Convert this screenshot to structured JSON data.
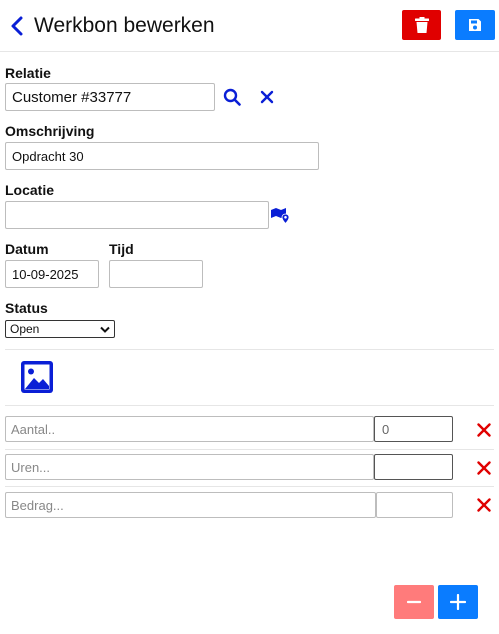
{
  "header": {
    "title": "Werkbon bewerken",
    "back_icon": "chevron-left-icon",
    "delete_icon": "trash-icon",
    "save_icon": "floppy-disk-icon",
    "delete_color": "#e00000",
    "save_color": "#0a7cff"
  },
  "relatie": {
    "label": "Relatie",
    "value": "Customer #33777",
    "search_icon": "search-icon",
    "clear_icon": "close-icon"
  },
  "omschrijving": {
    "label": "Omschrijving",
    "value": "Opdracht 30"
  },
  "locatie": {
    "label": "Locatie",
    "value": "",
    "map_icon": "map-marker-icon"
  },
  "datum": {
    "label": "Datum",
    "value": "10-09-2025"
  },
  "tijd": {
    "label": "Tijd",
    "value": ""
  },
  "status": {
    "label": "Status",
    "selected": "Open"
  },
  "photo": {
    "icon": "image-icon"
  },
  "lines": [
    {
      "placeholder": "Aantal..",
      "value": "0",
      "delete_icon": "close-icon"
    },
    {
      "placeholder": "Uren...",
      "value": "",
      "delete_icon": "close-icon"
    },
    {
      "placeholder": "Bedrag...",
      "value": "",
      "delete_icon": "close-icon"
    }
  ],
  "footer": {
    "minus_icon": "minus-icon",
    "plus_icon": "plus-icon",
    "minus_color": "#ff7b7b",
    "plus_color": "#0a7cff"
  },
  "colors": {
    "accent_blue": "#0a1fd6",
    "danger_red": "#e00000"
  }
}
